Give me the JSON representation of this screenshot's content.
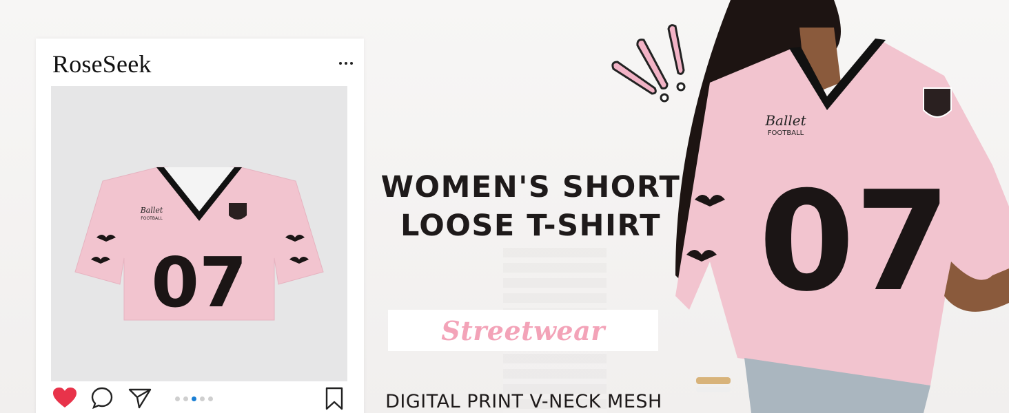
{
  "brand": "RoseSeek",
  "headline": {
    "line1": "WOMEN'S SHORT",
    "line2": "LOOSE T-SHIRT"
  },
  "tag": "Streetwear",
  "subline": "DIGITAL PRINT V-NECK MESH",
  "jersey": {
    "number": "07",
    "chest_text_1": "Ballet",
    "chest_text_2": "FOOTBALL"
  },
  "carousel": {
    "count": 5,
    "active_index": 2
  },
  "icons": {
    "more": "more-horizontal-icon",
    "like": "heart-filled-icon",
    "comment": "comment-bubble-icon",
    "share": "send-paper-plane-icon",
    "save": "bookmark-icon"
  },
  "colors": {
    "shirt_pink": "#f2c4cf",
    "accent_pink": "#f3a3b8",
    "like_red": "#e8334a",
    "carousel_active": "#1a7fd4",
    "ink": "#1e1a1a"
  }
}
